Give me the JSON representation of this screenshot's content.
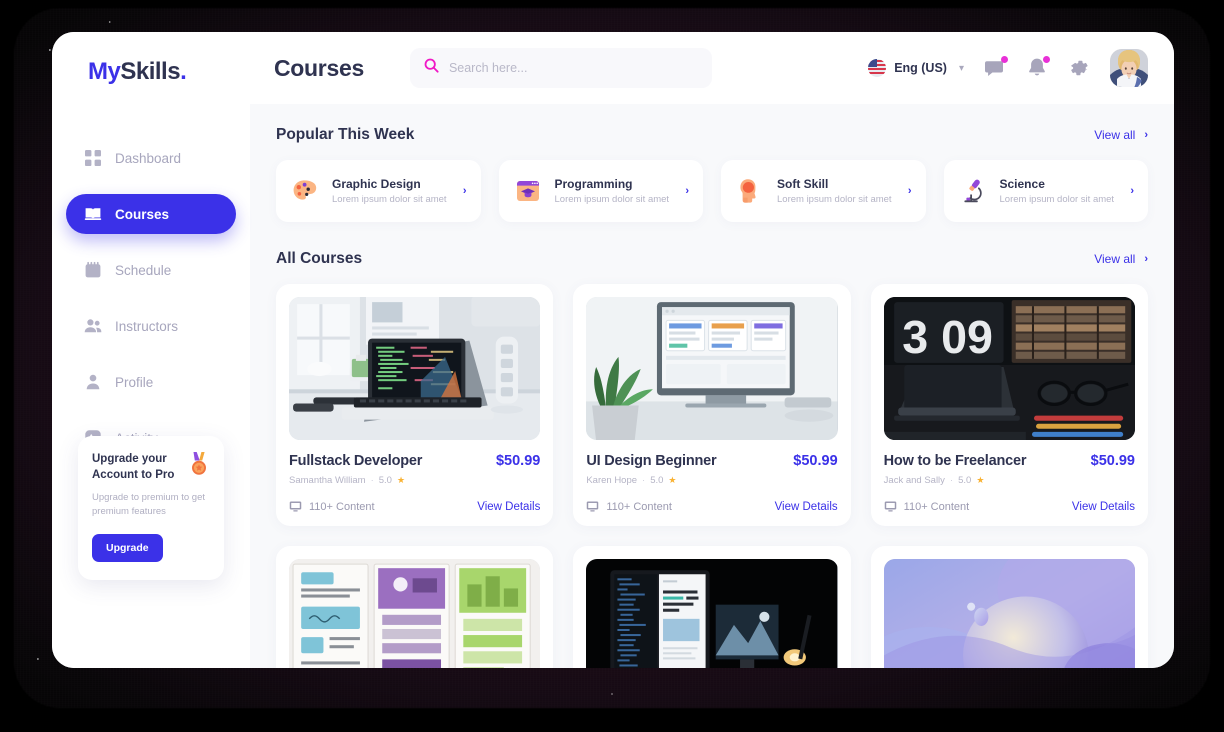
{
  "brand": {
    "part1": "My",
    "part2": "Skills",
    "dot": "."
  },
  "sidebar": {
    "items": [
      {
        "label": "Dashboard",
        "icon": "grid-icon",
        "active": false
      },
      {
        "label": "Courses",
        "icon": "book-icon",
        "active": true
      },
      {
        "label": "Schedule",
        "icon": "calendar-icon",
        "active": false
      },
      {
        "label": "Instructors",
        "icon": "users-icon",
        "active": false
      },
      {
        "label": "Profile",
        "icon": "person-icon",
        "active": false
      },
      {
        "label": "Activity",
        "icon": "activity-icon",
        "active": false
      }
    ],
    "upgrade": {
      "title": "Upgrade your Account to Pro",
      "subtitle": "Upgrade to premium to get premium features",
      "button": "Upgrade",
      "icon": "medal-icon"
    }
  },
  "header": {
    "page_title": "Courses",
    "search": {
      "placeholder": "Search here...",
      "value": "",
      "icon": "search-icon"
    },
    "language": {
      "label": "Eng (US)",
      "flag": "us-flag-icon",
      "chevron": "chevron-down-icon"
    },
    "icons": [
      {
        "name": "message-icon",
        "badge": true
      },
      {
        "name": "bell-icon",
        "badge": true
      },
      {
        "name": "gear-icon",
        "badge": false
      }
    ],
    "avatar": "user-avatar"
  },
  "popular": {
    "title": "Popular This Week",
    "view_all": "View all",
    "cards": [
      {
        "name": "Graphic Design",
        "sub": "Lorem ipsum dolor sit amet",
        "icon": "palette-icon"
      },
      {
        "name": "Programming",
        "sub": "Lorem ipsum dolor sit amet",
        "icon": "browser-graduation-icon"
      },
      {
        "name": "Soft Skill",
        "sub": "Lorem ipsum dolor sit amet",
        "icon": "head-brain-icon"
      },
      {
        "name": "Science",
        "sub": "Lorem ipsum dolor sit amet",
        "icon": "microscope-icon"
      }
    ]
  },
  "all_courses": {
    "title": "All Courses",
    "view_all": "View all",
    "cards": [
      {
        "name": "Fullstack Developer",
        "price": "$50.99",
        "author": "Samantha William",
        "rating": "5.0",
        "content": "110+ Content",
        "details": "View Details",
        "thumb": "laptop-code-desk"
      },
      {
        "name": "UI Design Beginner",
        "price": "$50.99",
        "author": "Karen Hope",
        "rating": "5.0",
        "content": "110+ Content",
        "details": "View Details",
        "thumb": "imac-design-plant"
      },
      {
        "name": "How to be Freelancer",
        "price": "$50.99",
        "author": "Jack and Sally",
        "rating": "5.0",
        "content": "110+ Content",
        "details": "View Details",
        "thumb": "dark-desk-glasses"
      },
      {
        "name": "",
        "price": "",
        "author": "",
        "rating": "",
        "content": "",
        "details": "",
        "thumb": "wireframe-sketches"
      },
      {
        "name": "",
        "price": "",
        "author": "",
        "rating": "",
        "content": "",
        "details": "",
        "thumb": "dark-imac-night"
      },
      {
        "name": "",
        "price": "",
        "author": "",
        "rating": "",
        "content": "",
        "details": "",
        "thumb": "gradient-abstract"
      }
    ]
  },
  "colors": {
    "accent": "#3b31e8",
    "magenta": "#e831d7",
    "text_dark": "#2f3350",
    "text_muted": "#b5b4c6",
    "star": "#f9b233",
    "content_bg": "#f8f9fb"
  }
}
